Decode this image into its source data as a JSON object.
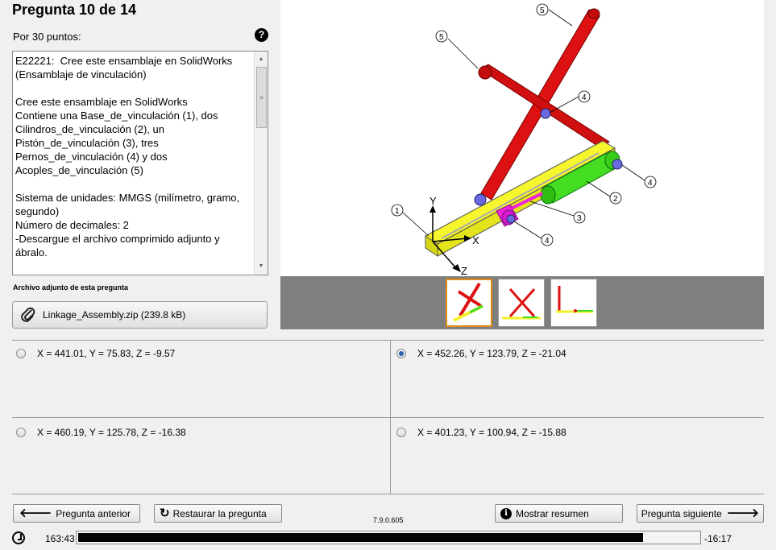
{
  "header": {
    "title": "Pregunta 10 de 14",
    "points": "Por 30 puntos:",
    "help_icon": "?"
  },
  "question": {
    "text": "E22221:  Cree este ensamblaje en SolidWorks (Ensamblaje de vinculación)\n\nCree este ensamblaje en SolidWorks\nContiene una Base_de_vinculación (1), dos Cilindros_de_vinculación (2), un Pistón_de_vinculación (3), tres Pernos_de_vinculación (4) y dos Acoples_de_vinculación (5)\n\nSistema de unidades: MMGS (milímetro, gramo, segundo)\nNúmero de decimales: 2\n-Descargue el archivo comprimido adjunto y ábralo."
  },
  "attachment": {
    "label": "Archivo adjunto de esta pregunta",
    "filename": "Linkage_Assembly.zip (239.8 kB)"
  },
  "figure": {
    "callouts": [
      "5",
      "5",
      "4",
      "4",
      "2",
      "3",
      "4",
      "1"
    ],
    "axes": {
      "y": "Y",
      "x": "X",
      "z": "Z"
    }
  },
  "choices": [
    {
      "text": "X = 441.01, Y = 75.83, Z = -9.57",
      "selected": false
    },
    {
      "text": "X = 452.26, Y = 123.79,  Z = -21.04",
      "selected": true
    },
    {
      "text": "X = 460.19, Y = 125.78, Z = -16.38",
      "selected": false
    },
    {
      "text": "X = 401.23, Y = 100.94, Z = -15.88",
      "selected": false
    }
  ],
  "nav": {
    "prev": "Pregunta anterior",
    "reset": "Restaurar la pregunta",
    "version": "7.9.0.605",
    "summary": "Mostrar resumen",
    "next": "Pregunta siguiente"
  },
  "timer": {
    "elapsed": "163:43",
    "remaining": "-16:17",
    "progress": 0.91
  },
  "colors": {
    "accent_selected_thumb": "#e08a16",
    "link_red": "#dd1111",
    "base_yellow": "#f2f22a",
    "cylinder_green": "#44dd22",
    "piston_magenta": "#ee22dd",
    "pin_blue": "#6a6ae0"
  }
}
